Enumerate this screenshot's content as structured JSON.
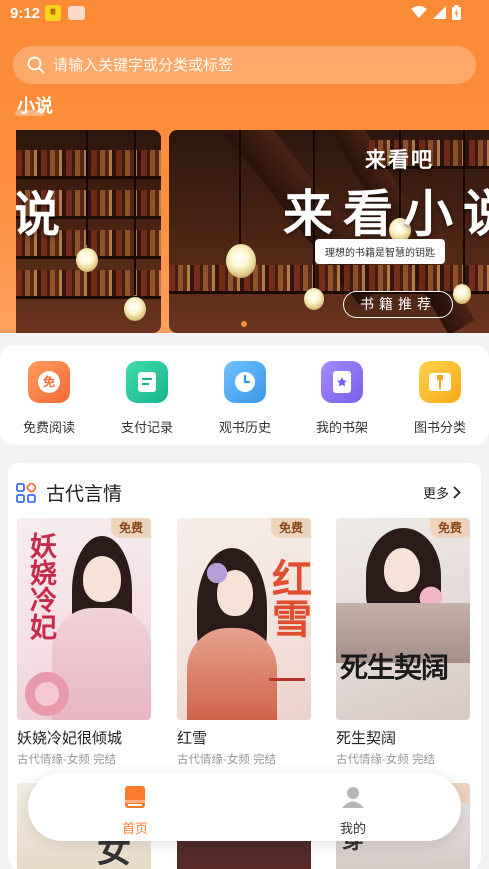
{
  "status_bar": {
    "time": "9:12"
  },
  "search": {
    "placeholder": "请输入关键字或分类或标签"
  },
  "section": {
    "title": "小说"
  },
  "banner": {
    "left_text": "说",
    "small_title": "来看吧",
    "main_title": "来看小说",
    "slogan": "理想的书籍是智慧的钥匙",
    "button": "书籍推荐"
  },
  "quick_actions": [
    {
      "label": "免费阅读",
      "icon": "free-read-icon",
      "color": "#fc7a46",
      "glyph": "免"
    },
    {
      "label": "支付记录",
      "icon": "payment-record-icon",
      "color": "#21c196"
    },
    {
      "label": "观书历史",
      "icon": "history-clock-icon",
      "color": "#4ba9f2"
    },
    {
      "label": "我的书架",
      "icon": "bookshelf-icon",
      "color": "#8a6ff2"
    },
    {
      "label": "图书分类",
      "icon": "category-book-icon",
      "color": "#fbbd2a"
    }
  ],
  "category": {
    "title": "古代言情",
    "more": "更多",
    "books": [
      {
        "name": "妖娆冷妃很倾城",
        "meta": "古代情缘-女频 完结",
        "badge": "免费",
        "cover_text": "妖娆冷妃"
      },
      {
        "name": "红雪",
        "meta": "古代情缘-女频 完结",
        "badge": "免费",
        "cover_text": "红雪"
      },
      {
        "name": "死生契阔",
        "meta": "古代情缘-女频 完结",
        "badge": "免费",
        "cover_text": "死生契阔"
      }
    ],
    "row2_cover_texts": [
      "女",
      "",
      "穿"
    ]
  },
  "tabs": [
    {
      "label": "首页",
      "active": true,
      "color": "#fd7a2c"
    },
    {
      "label": "我的",
      "active": false,
      "color": "#333333"
    }
  ]
}
